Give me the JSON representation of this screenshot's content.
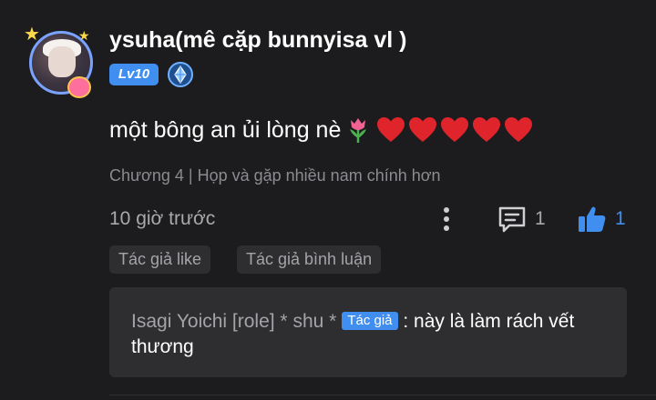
{
  "user": {
    "name": "ysuha(mê cặp bunnyisa vl )",
    "level_label": "Lv10",
    "avatar_icon": "user-avatar",
    "rank_icon": "diamond-rank-icon"
  },
  "comment": {
    "text": "một bông an ủi lòng nè",
    "emojis": [
      "tulip-icon",
      "heart-icon",
      "heart-icon",
      "heart-icon",
      "heart-icon",
      "heart-icon"
    ],
    "chapter": "Chương 4 | Họp và gặp nhiều nam chính hơn",
    "time": "10 giờ trước",
    "reply_count": "1",
    "like_count": "1"
  },
  "tags": {
    "author_like": "Tác giả like",
    "author_comment": "Tác giả bình luận"
  },
  "reply": {
    "author": "Isagi Yoichi [role] * shu *",
    "badge": "Tác giả",
    "separator": " : ",
    "text": "này là làm rách vết thương"
  },
  "colors": {
    "background": "#1c1c1e",
    "accent_blue": "#3f8ef0",
    "heart_red": "#e0242b",
    "muted_text": "#8b8b90",
    "tag_background": "#2e2e31"
  }
}
